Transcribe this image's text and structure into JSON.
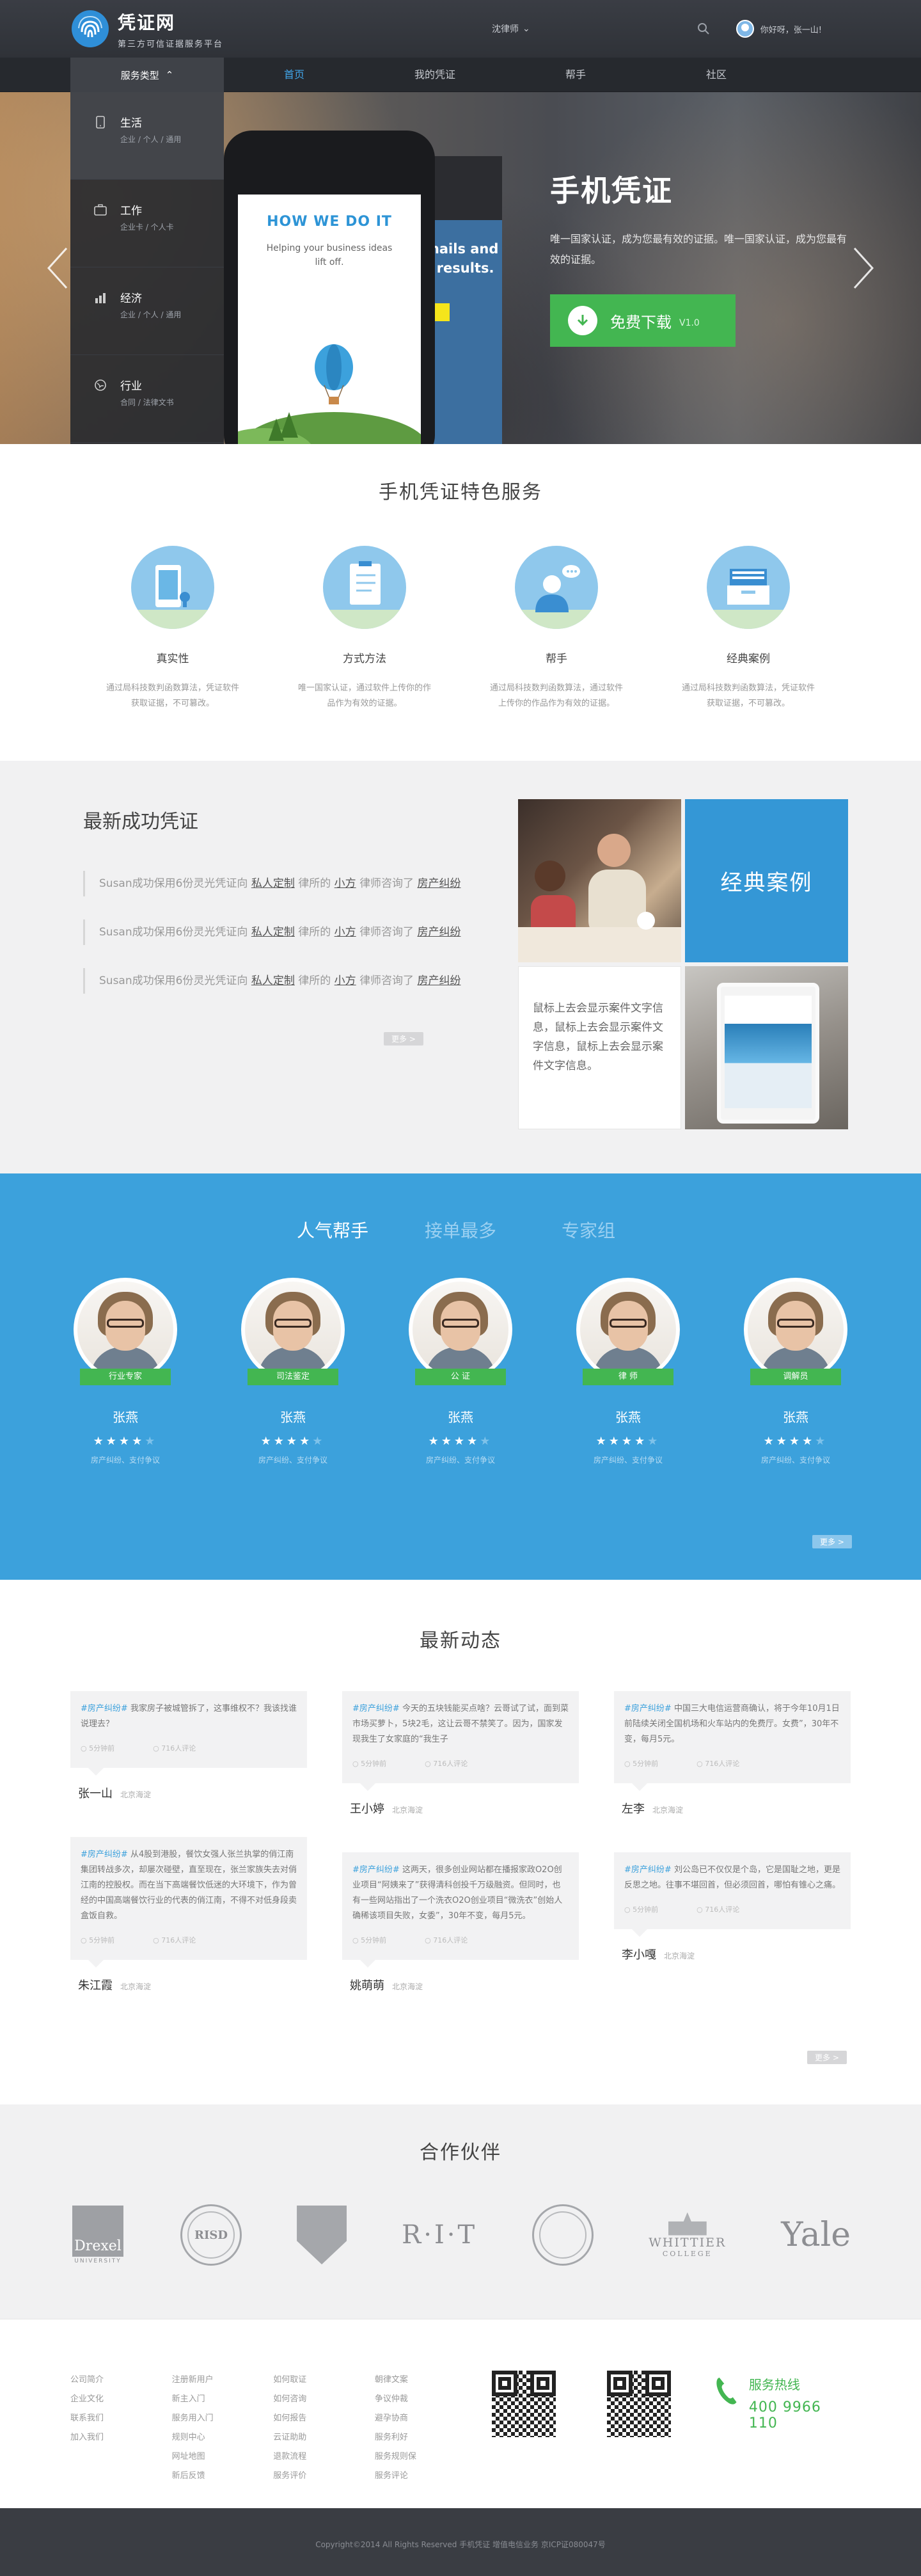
{
  "header": {
    "site_name": "凭证网",
    "slogan": "第三方可信证据服务平台",
    "city": "沈律师",
    "user_greeting": "你好呀，张一山!"
  },
  "nav": {
    "service_type": "服务类型",
    "items": [
      {
        "label": "首页",
        "active": true
      },
      {
        "label": "我的凭证",
        "active": false
      },
      {
        "label": "帮手",
        "active": false
      },
      {
        "label": "社区",
        "active": false
      }
    ],
    "dropdown": [
      {
        "title": "生活",
        "sub": "企业 / 个人 / 通用",
        "icon": "phone-icon"
      },
      {
        "title": "工作",
        "sub": "企业卡 / 个人卡",
        "icon": "briefcase-icon"
      },
      {
        "title": "经济",
        "sub": "企业 / 个人 / 通用",
        "icon": "bar-chart-icon"
      },
      {
        "title": "行业",
        "sub": "合同 / 法律文书",
        "icon": "globe-icon"
      }
    ]
  },
  "hero": {
    "phone_heading": "HOW WE DO IT",
    "phone_text": "Helping your business ideas lift off.",
    "phone2_text": "mails and r results.",
    "title": "手机凭证",
    "desc": "唯一国家认证，成为您最有效的证据。唯一国家认证，成为您最有效的证据。",
    "download_label": "免费下载",
    "version": "V1.0"
  },
  "features": {
    "title": "手机凭证特色服务",
    "items": [
      {
        "name": "真实性",
        "desc": "通过局科技数判函数算法，凭证软件获取证据，不可篡改。",
        "icon": "phone-certificate-icon"
      },
      {
        "name": "方式方法",
        "desc": "唯一国家认证，通过软件上传你的作品作为有效的证据。",
        "icon": "clipboard-icon"
      },
      {
        "name": "帮手",
        "desc": "通过局科技数判函数算法，通过软件上传你的作品作为有效的证据。",
        "icon": "helper-chat-icon"
      },
      {
        "name": "经典案例",
        "desc": "通过局科技数判函数算法，凭证软件获取证据，不可篡改。",
        "icon": "inbox-tray-icon"
      }
    ]
  },
  "success": {
    "title": "最新成功凭证",
    "items": [
      {
        "pre": "Susan成功保用6份灵光凭证向",
        "l1": "私人定制",
        "mid": "律所的",
        "l2": "小方",
        "post": "律师咨询了",
        "l3": "房产纠纷"
      },
      {
        "pre": "Susan成功保用6份灵光凭证向",
        "l1": "私人定制",
        "mid": "律所的",
        "l2": "小方",
        "post": "律师咨询了",
        "l3": "房产纠纷"
      },
      {
        "pre": "Susan成功保用6份灵光凭证向",
        "l1": "私人定制",
        "mid": "律所的",
        "l2": "小方",
        "post": "律师咨询了",
        "l3": "房产纠纷"
      }
    ],
    "more": "更多 >",
    "case_label": "经典案例",
    "case_text": "鼠标上去会显示案件文字信息，鼠标上去会显示案件文字信息，鼠标上去会显示案件文字信息。"
  },
  "helpers": {
    "tabs": [
      {
        "label": "人气帮手",
        "active": true
      },
      {
        "label": "接单最多",
        "active": false
      },
      {
        "label": "专家组",
        "active": false
      }
    ],
    "people": [
      {
        "badge": "行业专家",
        "name": "张燕",
        "stars": 4,
        "tags": "房产纠纷、支付争议"
      },
      {
        "badge": "司法鉴定",
        "name": "张燕",
        "stars": 4,
        "tags": "房产纠纷、支付争议"
      },
      {
        "badge": "公 证",
        "name": "张燕",
        "stars": 4,
        "tags": "房产纠纷、支付争议"
      },
      {
        "badge": "律 师",
        "name": "张燕",
        "stars": 4,
        "tags": "房产纠纷、支付争议"
      },
      {
        "badge": "调解员",
        "name": "张燕",
        "stars": 4,
        "tags": "房产纠纷、支付争议"
      }
    ],
    "more": "更多 >"
  },
  "news": {
    "title": "最新动态",
    "columns": [
      [
        {
          "tag": "#房产纠纷#",
          "text": "我家房子被城管拆了，这事维权不？我该找谁说理去？",
          "time": "5分钟前",
          "comments": "716人评论",
          "author": "张一山",
          "loc": "北京海淀"
        },
        {
          "tag": "#房产纠纷#",
          "text": "从4股到港股，餐饮女强人张兰执掌的俏江南集团转战多次，却屡次碰壁，直至现在，张兰家族失去对俏江南的控股权。而在当下高端餐饮低迷的大环境下，作为曾经的中国高端餐饮行业的代表的俏江南，不得不对低身段卖盒饭自救。",
          "time": "5分钟前",
          "comments": "716人评论",
          "author": "朱江霞",
          "loc": "北京海淀"
        }
      ],
      [
        {
          "tag": "#房产纠纷#",
          "text": "今天的五块钱能买点啥？云哥试了试，面到菜市场买萝卜，5块2毛，这让云哥不禁笑了。因为，国家发现我生了女家庭的“我生子",
          "time": "5分钟前",
          "comments": "716人评论",
          "author": "王小婷",
          "loc": "北京海淀"
        },
        {
          "tag": "#房产纠纷#",
          "text": "这两天，很多创业网站都在播报家政O2O创业项目“阿姨来了”获得清科创投千万级融资。但同时，也有一些网站指出了一个洗衣O2O创业项目“微洗衣”创始人确稀该项目失败，女委”，30年不变，每月5元。",
          "time": "5分钟前",
          "comments": "716人评论",
          "author": "姚萌萌",
          "loc": "北京海淀"
        }
      ],
      [
        {
          "tag": "#房产纠纷#",
          "text": "中国三大电信运营商确认，将于今年10月1日前陆续关闭全国机场和火车站内的免费厅。女费”，30年不变，每月5元。",
          "time": "5分钟前",
          "comments": "716人评论",
          "author": "左李",
          "loc": "北京海淀"
        },
        {
          "tag": "#房产纠纷#",
          "text": "刘公岛已不仅仅是个岛，它是国耻之地，更是反思之地。往事不堪回首，但必须回首，哪怕有锥心之痛。",
          "time": "5分钟前",
          "comments": "716人评论",
          "author": "李小嘎",
          "loc": "北京海淀"
        }
      ]
    ],
    "more": "更多 >"
  },
  "partners": {
    "title": "合作伙伴",
    "logos": [
      {
        "name": "Drexel",
        "sub": "UNIVERSITY"
      },
      {
        "name": "RISD"
      },
      {
        "name": "shield"
      },
      {
        "name": "R·I·T"
      },
      {
        "name": "seal"
      },
      {
        "name": "WHITTIER",
        "sub": "COLLEGE"
      },
      {
        "name": "Yale"
      }
    ]
  },
  "footer": {
    "cols": [
      [
        "公司简介",
        "企业文化",
        "联系我们",
        "加入我们"
      ],
      [
        "注册新用户",
        "新主入门",
        "服务用入门",
        "规则中心",
        "网址地图",
        "新后反馈"
      ],
      [
        "如何取证",
        "如何咨询",
        "如何报告",
        "云证助助",
        "退款流程",
        "服务评价"
      ],
      [
        "朝律文案",
        "争议仲裁",
        "避孕协商",
        "服务利好",
        "服务规则保",
        "服务评论"
      ]
    ],
    "hotline_label": "服务热线",
    "hotline_number": "400 9966 110",
    "copyright": "Copyright©2014  All Rights Reserved 手机凭证  增值电信业务 京ICP证080047号"
  }
}
